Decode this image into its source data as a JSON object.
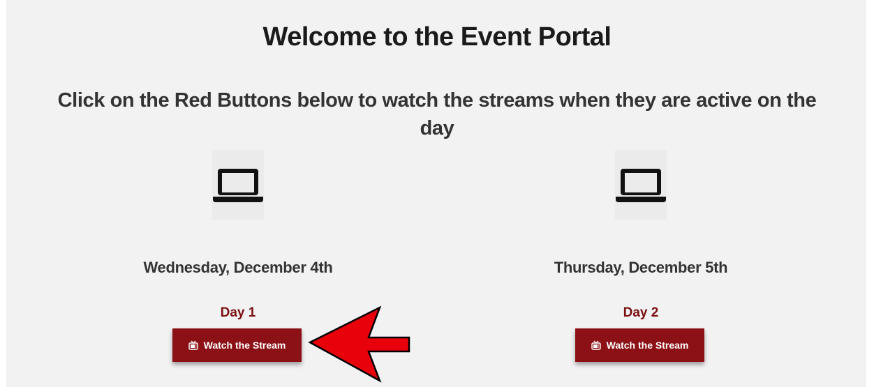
{
  "header": {
    "title": "Welcome to the Event Portal",
    "subtitle": "Click on the Red Buttons below to watch the streams when they are active on the day"
  },
  "days": [
    {
      "date": "Wednesday, December 4th",
      "label": "Day 1",
      "button_label": "Watch the Stream",
      "icon": "laptop-icon"
    },
    {
      "date": "Thursday, December 5th",
      "label": "Day 2",
      "button_label": "Watch the Stream",
      "icon": "laptop-icon"
    }
  ],
  "colors": {
    "background": "#f2f2f2",
    "accent": "#8c1116",
    "day_label": "#7b0f12",
    "annotation_arrow": "#e8000b"
  }
}
